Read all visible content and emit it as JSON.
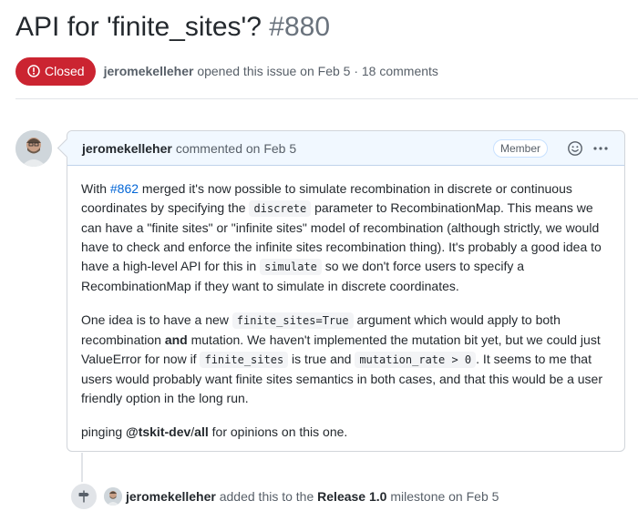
{
  "issue": {
    "title": "API for 'finite_sites'?",
    "number": "#880",
    "state_label": "Closed",
    "author": "jeromekelleher",
    "opened_text": "opened this issue on Feb 5 · 18 comments"
  },
  "comment": {
    "author": "jeromekelleher",
    "action": "commented on Feb 5",
    "role": "Member",
    "p1": {
      "t1": "With ",
      "link": "#862",
      "t2": " merged it's now possible to simulate recombination in discrete or continuous coordinates by specifying the ",
      "code1": "discrete",
      "t3": " parameter to RecombinationMap. This means we can have a \"finite sites\" or \"infinite sites\" model of recombination (although strictly, we would have to check and enforce the infinite sites recombination thing). It's probably a good idea to have a high-level API for this in ",
      "code2": "simulate",
      "t4": " so we don't force users to specify a RecombinationMap if they want to simulate in discrete coordinates."
    },
    "p2": {
      "t1": "One idea is to have a new ",
      "code1": "finite_sites=True",
      "t2": " argument which would apply to both recombination ",
      "bold": "and",
      "t3": " mutation. We haven't implemented the mutation bit yet, but we could just ValueError for now if ",
      "code2": "finite_sites",
      "t4": " is true and ",
      "code3": "mutation_rate > 0",
      "t5": ". It seems to me that users would probably want finite sites semantics in both cases, and that this would be a user friendly option in the long run."
    },
    "p3": {
      "t1": "pinging ",
      "mention_org": "@tskit-dev",
      "slash": "/",
      "mention_team": "all",
      "t2": " for opinions on this one."
    }
  },
  "event": {
    "actor": "jeromekelleher",
    "text1": " added this to the ",
    "milestone": "Release 1.0",
    "text2": " milestone on Feb 5"
  },
  "icons": {
    "state": "issue-closed-icon",
    "reaction": "smiley-icon",
    "menu": "kebab-horizontal-icon",
    "event": "milestone-icon"
  },
  "colors": {
    "closed": "#cb2431",
    "link": "#0366d6",
    "header_bg": "#f1f8ff"
  }
}
